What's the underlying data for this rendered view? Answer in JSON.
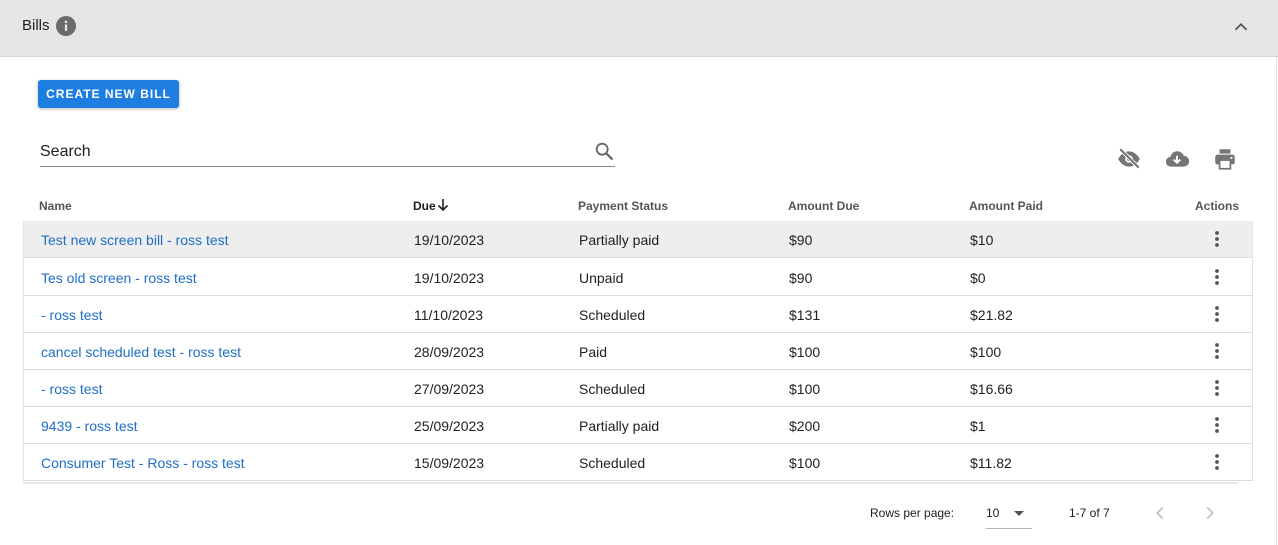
{
  "header": {
    "title": "Bills",
    "info_icon": "info-icon",
    "collapse_icon": "chevron-up-icon"
  },
  "toolbar": {
    "create_label": "CREATE NEW BILL",
    "search_placeholder": "Search",
    "icons": [
      "visibility-off-icon",
      "cloud-download-icon",
      "print-icon"
    ]
  },
  "table": {
    "columns": [
      "Name",
      "Due",
      "Payment Status",
      "Amount Due",
      "Amount Paid",
      "Actions"
    ],
    "sort_icon": "arrow-down-icon",
    "rows": [
      {
        "name": "Test new screen bill - ross test",
        "due": "19/10/2023",
        "status": "Partially paid",
        "amount_due": "$90",
        "amount_paid": "$10"
      },
      {
        "name": "Tes old screen - ross test",
        "due": "19/10/2023",
        "status": "Unpaid",
        "amount_due": "$90",
        "amount_paid": "$0"
      },
      {
        "name": "- ross test",
        "due": "11/10/2023",
        "status": "Scheduled",
        "amount_due": "$131",
        "amount_paid": "$21.82"
      },
      {
        "name": "cancel scheduled test - ross test",
        "due": "28/09/2023",
        "status": "Paid",
        "amount_due": "$100",
        "amount_paid": "$100"
      },
      {
        "name": "- ross test",
        "due": "27/09/2023",
        "status": "Scheduled",
        "amount_due": "$100",
        "amount_paid": "$16.66"
      },
      {
        "name": "9439 - ross test",
        "due": "25/09/2023",
        "status": "Partially paid",
        "amount_due": "$200",
        "amount_paid": "$1"
      },
      {
        "name": "Consumer Test - Ross - ross test",
        "due": "15/09/2023",
        "status": "Scheduled",
        "amount_due": "$100",
        "amount_paid": "$11.82"
      }
    ]
  },
  "pagination": {
    "rows_per_page_label": "Rows per page:",
    "rows_per_page": "10",
    "range": "1-7 of 7"
  },
  "colors": {
    "accent": "#1e7de0",
    "link": "#1e6fc8",
    "header_bg": "#e6e6e6"
  }
}
